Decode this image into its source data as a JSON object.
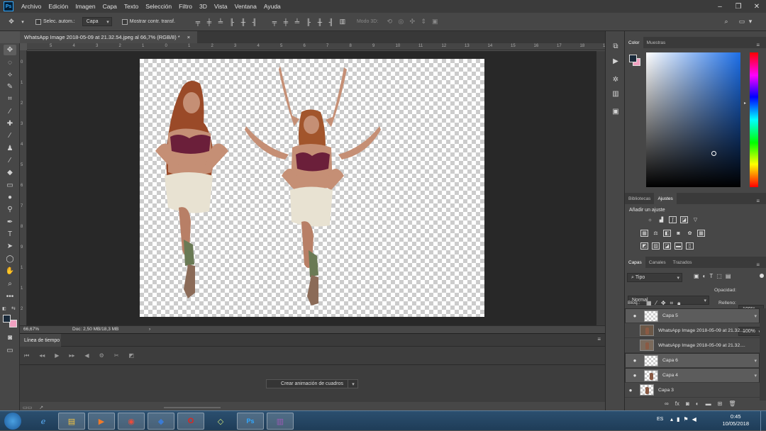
{
  "app": {
    "logo": "Ps",
    "menu": [
      "Archivo",
      "Edición",
      "Imagen",
      "Capa",
      "Texto",
      "Selección",
      "Filtro",
      "3D",
      "Vista",
      "Ventana",
      "Ayuda"
    ]
  },
  "options": {
    "auto_select_label": "Selec. autom.:",
    "auto_select_value": "Capa",
    "show_transform_label": "Mostrar contr. transf.",
    "mode3d_label": "Modo 3D:"
  },
  "document": {
    "tab_title": "WhatsApp Image 2018-05-09 at 21.32.54.jpeg al 66,7% (RGB/8) *",
    "close_glyph": "×",
    "zoom": "66,67%",
    "doc_info": "Doc: 2,50 MB/18,3 MB"
  },
  "ruler": {
    "h_ticks": [
      "5",
      "4",
      "3",
      "2",
      "1",
      "0",
      "1",
      "2",
      "3",
      "4",
      "5",
      "6",
      "7",
      "8",
      "9",
      "10",
      "11",
      "12",
      "13",
      "14",
      "15",
      "16",
      "17",
      "18",
      "19"
    ],
    "v_ticks": [
      "0",
      "1",
      "2",
      "3",
      "4",
      "5",
      "6",
      "7",
      "8",
      "9",
      "1",
      "1",
      "2"
    ]
  },
  "timeline": {
    "tab_label": "Línea de tiempo",
    "create_button": "Crear animación de cuadros"
  },
  "color_panel": {
    "tabs": [
      "Color",
      "Muestras"
    ],
    "foreground": "#1a2a3a",
    "background": "#f0a0c0",
    "hue_base": "#1d6fe8"
  },
  "adjust_panel": {
    "tabs": [
      "Bibliotecas",
      "Ajustes"
    ],
    "title": "Añadir un ajuste"
  },
  "layers_panel": {
    "tabs": [
      "Capas",
      "Canales",
      "Trazados"
    ],
    "filter_label": "Tipo",
    "blend_mode": "Normal",
    "opacity_label": "Opacidad:",
    "opacity_value": "100%",
    "lock_label": "Bloq.:",
    "fill_label": "Relleno:",
    "fill_value": "100%",
    "layers": [
      {
        "name": "Capa 5",
        "visible": true,
        "selected": true,
        "thumb": "checker"
      },
      {
        "name": "WhatsApp Image 2018-05-09 at 21.32....",
        "visible": false,
        "selected": false,
        "thumb": "photo"
      },
      {
        "name": "WhatsApp Image 2018-05-09 at 21.32....",
        "visible": false,
        "selected": false,
        "thumb": "photo"
      },
      {
        "name": "Capa 6",
        "visible": true,
        "selected": true,
        "thumb": "checker"
      },
      {
        "name": "Capa 4",
        "visible": true,
        "selected": true,
        "thumb": "figure"
      },
      {
        "name": "Capa 3",
        "visible": true,
        "selected": false,
        "thumb": "figure"
      }
    ]
  },
  "taskbar": {
    "lang": "ES",
    "time": "0:45",
    "date": "10/05/2018"
  }
}
